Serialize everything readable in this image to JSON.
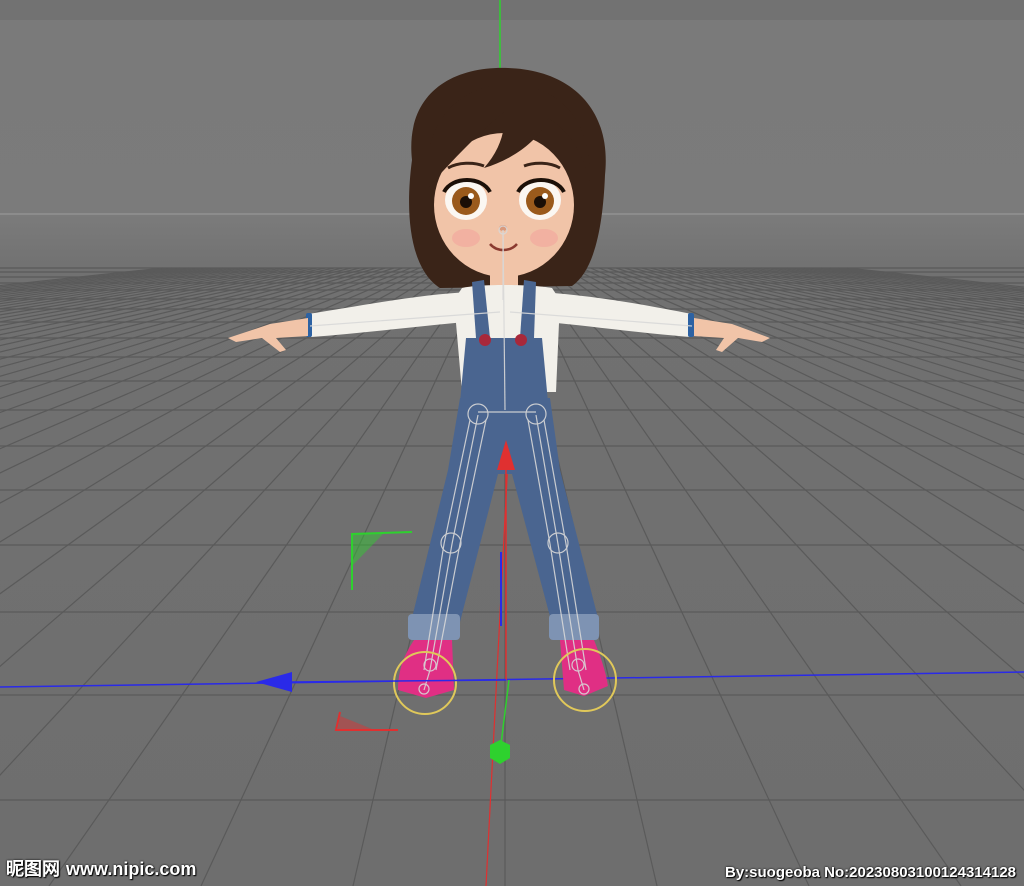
{
  "viewport": {
    "background_color": "#777777",
    "grid_color": "#5a5a5a",
    "horizon_color": "#8c8c8c",
    "axis_colors": {
      "x": "#e03030",
      "y": "#2ed12e",
      "z": "#2a2ae8"
    }
  },
  "character": {
    "skin_color": "#f1c4a8",
    "hair_color": "#3a2418",
    "eye_color": "#9a5a1c",
    "shirt_color": "#f2f0ea",
    "overalls_color": "#4a6590",
    "cuff_color": "#7e93b3",
    "shoe_color": "#e02f84",
    "rig_color": "#d8d8d8",
    "ik_control_color": "#e0c85a"
  },
  "watermark": {
    "site_name": "昵图网",
    "site_url": "www.nipic.com",
    "credit": "By:suogeoba No:20230803100124314128"
  }
}
